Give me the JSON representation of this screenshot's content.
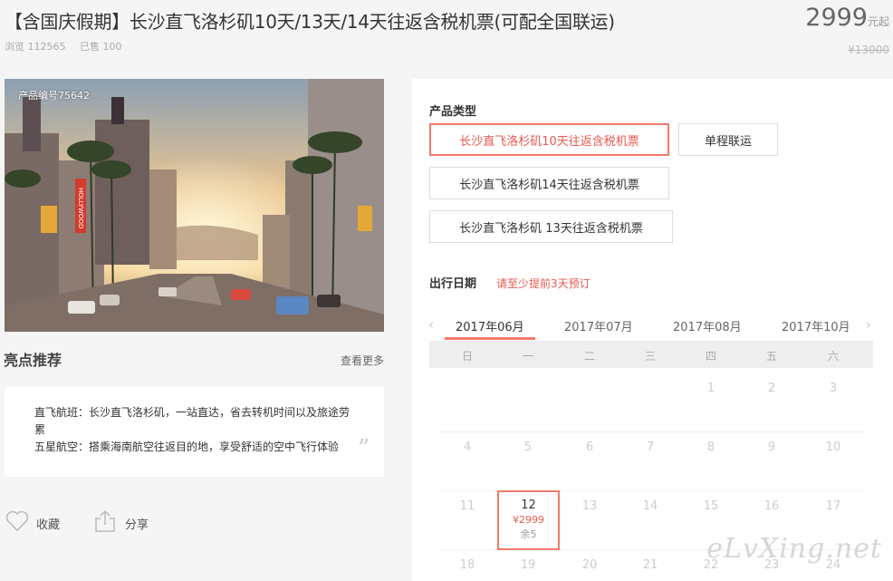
{
  "header": {
    "title": "【含国庆假期】长沙直飞洛杉矶10天/13天/14天往返含税机票(可配全国联运)",
    "views": "浏览 112565",
    "sold": "已售 100",
    "price": "2999",
    "price_unit": "元起",
    "original_price": "¥13000"
  },
  "photo": {
    "product_code": "产品编号75642",
    "sign_text": "HOLLYWOOD"
  },
  "highlights": {
    "title": "亮点推荐",
    "more": "查看更多",
    "lines": [
      "直飞航班：长沙直飞洛杉矶，一站直达，省去转机时间以及旅途劳累",
      "五星航空：搭乘海南航空往返目的地，享受舒适的空中飞行体验"
    ]
  },
  "actions": {
    "favorite": "收藏",
    "share": "分享"
  },
  "product_type": {
    "label": "产品类型",
    "options": [
      "长沙直飞洛杉矶10天往返含税机票",
      "单程联运",
      "长沙直飞洛杉矶14天往返含税机票",
      "长沙直飞洛杉矶 13天往返含税机票"
    ],
    "selected_index": 0
  },
  "date": {
    "label": "出行日期",
    "note": "请至少提前3天预订",
    "months": [
      "2017年06月",
      "2017年07月",
      "2017年08月",
      "2017年10月"
    ],
    "active_month_index": 0,
    "prev_icon": "chevron-left-icon",
    "next_icon": "chevron-right-icon",
    "weekdays": [
      "日",
      "一",
      "二",
      "三",
      "四",
      "五",
      "六"
    ],
    "rows": [
      [
        "",
        "",
        "",
        "",
        "1",
        "2",
        "3"
      ],
      [
        "4",
        "5",
        "6",
        "7",
        "8",
        "9",
        "10"
      ],
      [
        "11",
        "12",
        "13",
        "14",
        "15",
        "16",
        "17"
      ],
      [
        "18",
        "19",
        "20",
        "21",
        "22",
        "23",
        "24"
      ]
    ],
    "selected_day": {
      "day": "12",
      "price": "¥2999",
      "remaining": "余5"
    }
  },
  "watermark": "eLvXing.net",
  "colors": {
    "accent": "#e85a4f",
    "accent_border": "#f07a6a"
  }
}
